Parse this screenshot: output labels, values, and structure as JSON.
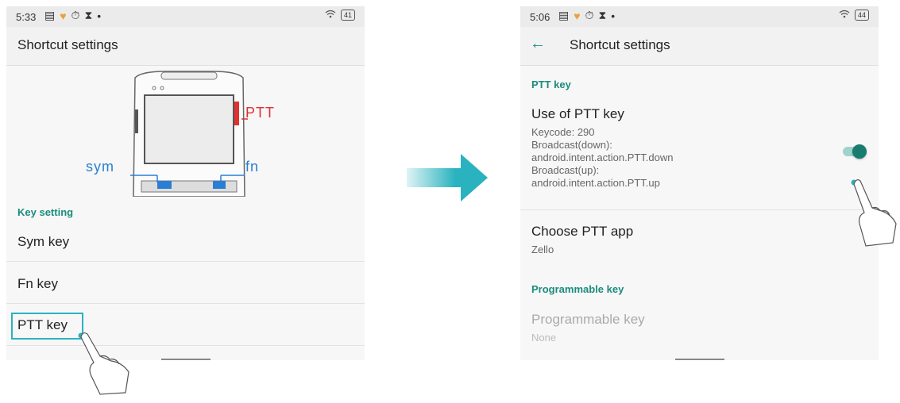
{
  "left_screen": {
    "status": {
      "time": "5:33",
      "battery": "41"
    },
    "title": "Shortcut settings",
    "device_labels": {
      "ptt": "PTT",
      "sym": "sym",
      "fn": "fn"
    },
    "section_header": "Key setting",
    "items": [
      "Sym key",
      "Fn key",
      "PTT key"
    ]
  },
  "right_screen": {
    "status": {
      "time": "5:06",
      "battery": "44"
    },
    "title": "Shortcut settings",
    "ptt_section": {
      "header": "PTT key",
      "use_title": "Use of PTT key",
      "use_details": "Keycode: 290\nBroadcast(down):\nandroid.intent.action.PTT.down\nBroadcast(up):\nandroid.intent.action.PTT.up",
      "toggle_on": true,
      "choose_title": "Choose PTT app",
      "choose_value": "Zello"
    },
    "programmable_section": {
      "header": "Programmable key",
      "title": "Programmable key",
      "value": "None"
    }
  },
  "colors": {
    "accent": "#1a8c7c",
    "ptt_label": "#e03030",
    "device_label": "#2a7fd4",
    "arrow": "#2ab3bf"
  }
}
